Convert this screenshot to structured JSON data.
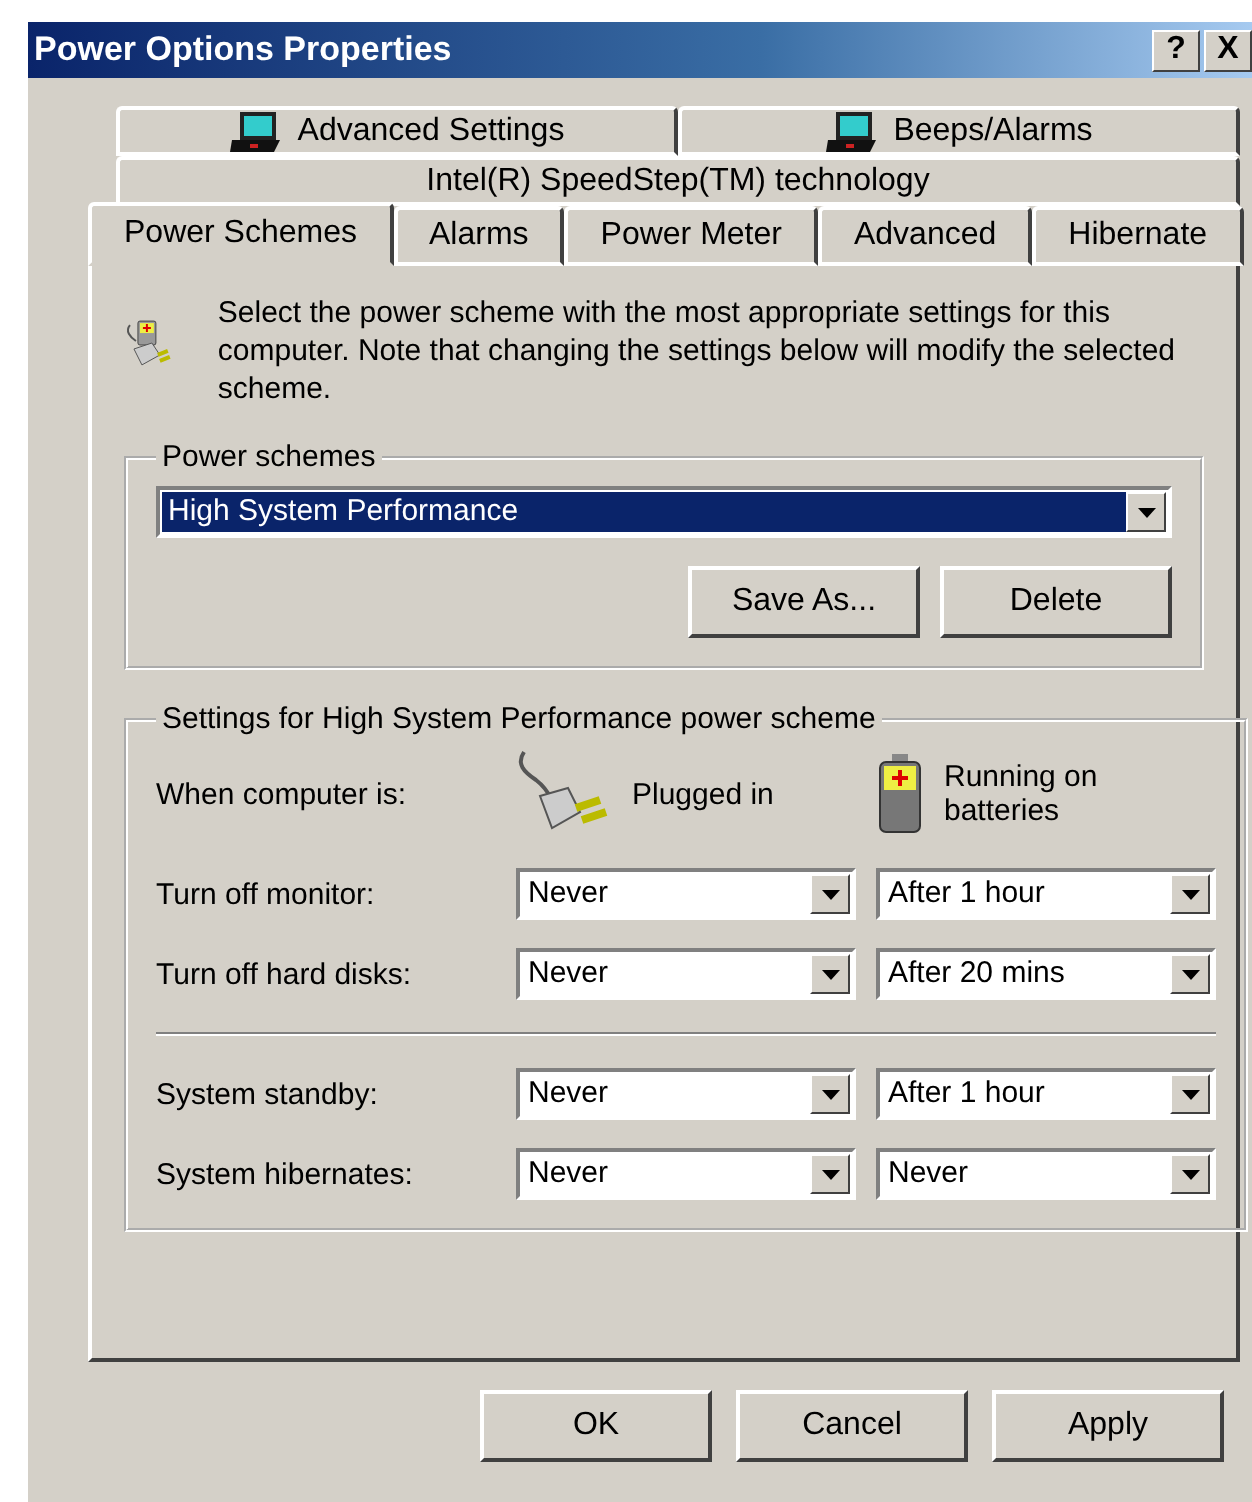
{
  "window": {
    "title": "Power Options Properties",
    "buttons": [
      "?",
      "X"
    ]
  },
  "tab_rows": [
    [
      {
        "label": "Advanced Settings",
        "kind": "laptop",
        "selected": false
      },
      {
        "label": "Beeps/Alarms",
        "kind": "laptop",
        "selected": false
      }
    ],
    [
      {
        "label": "Intel(R) SpeedStep(TM) technology",
        "kind": "text",
        "selected": false
      }
    ],
    [
      {
        "label": "Power Schemes",
        "kind": "text",
        "selected": true
      },
      {
        "label": "Alarms",
        "kind": "text",
        "selected": false
      },
      {
        "label": "Power Meter",
        "kind": "text",
        "selected": false
      },
      {
        "label": "Advanced",
        "kind": "text",
        "selected": false
      },
      {
        "label": "Hibernate",
        "kind": "text",
        "selected": false
      }
    ]
  ],
  "intro": "Select the power scheme with the most appropriate settings for this computer. Note that changing the settings below will modify the selected scheme.",
  "power_schemes": {
    "legend": "Power schemes",
    "value": "High System Performance",
    "buttons": [
      "Save As...",
      "Delete"
    ]
  },
  "settings": {
    "legend": "Settings for High System Performance power scheme",
    "when_label": "When computer is:",
    "plugged_label": "Plugged in",
    "battery_label": "Running on batteries",
    "rows": [
      {
        "kind": "setting",
        "label": "Turn off monitor:",
        "plugged": "Never",
        "battery": "After 1 hour"
      },
      {
        "kind": "setting",
        "label": "Turn off hard disks:",
        "plugged": "Never",
        "battery": "After 20 mins"
      },
      {
        "kind": "separator"
      },
      {
        "kind": "setting",
        "label": "System standby:",
        "plugged": "Never",
        "battery": "After 1 hour"
      },
      {
        "kind": "setting",
        "label": "System hibernates:",
        "plugged": "Never",
        "battery": "Never"
      }
    ]
  },
  "dialog_buttons": [
    "OK",
    "Cancel",
    "Apply"
  ]
}
